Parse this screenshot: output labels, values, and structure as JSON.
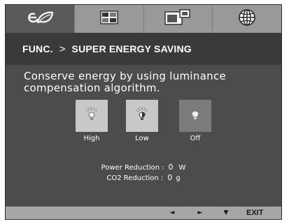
{
  "tabs": [
    {
      "icon": "leaf-eco-icon",
      "active": true
    },
    {
      "icon": "picture-settings-icon",
      "active": false
    },
    {
      "icon": "screen-layout-icon",
      "active": false
    },
    {
      "icon": "globe-language-icon",
      "active": false
    }
  ],
  "header": {
    "section": "FUNC.",
    "separator": ">",
    "title": "SUPER ENERGY SAVING"
  },
  "description": "Conserve energy by using luminance compensation algorithm.",
  "options": [
    {
      "label": "High",
      "icon": "bulb-bright-icon",
      "selected": false
    },
    {
      "label": "Low",
      "icon": "bulb-dim-icon",
      "selected": false
    },
    {
      "label": "Off",
      "icon": "bulb-off-icon",
      "selected": true
    }
  ],
  "stats": {
    "power_label": "Power Reduction :",
    "power_value": "0",
    "power_unit": "W",
    "co2_label": "CO2 Reduction :",
    "co2_value": "0",
    "co2_unit": "g"
  },
  "footer": {
    "left": "◄",
    "right": "►",
    "down": "▼",
    "exit": "EXIT"
  },
  "colors": {
    "panel": "#4c4c4c",
    "header": "#3a3a3a",
    "tab_bar": "#999999",
    "footer": "#a6a6a6",
    "option_bg": "#c8c8c8",
    "option_selected_bg": "#7b7b7b"
  }
}
